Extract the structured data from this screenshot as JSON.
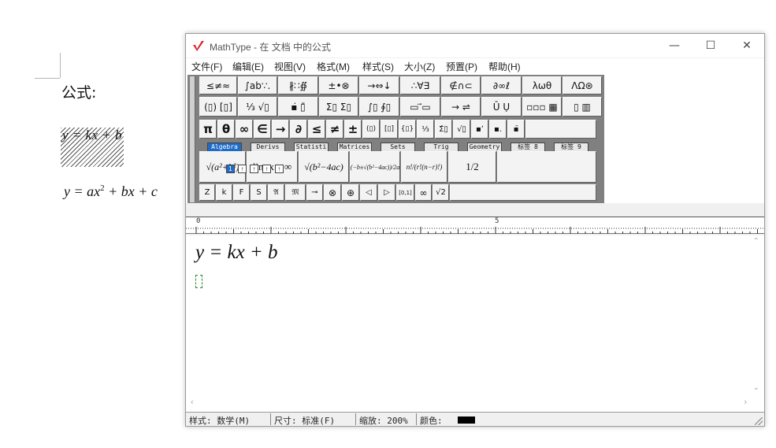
{
  "document": {
    "label": "公式:",
    "eq_selected": "y = kx + b",
    "eq2_part1": "y = ax",
    "eq2_sup": "2",
    "eq2_part2": " + bx + c"
  },
  "window": {
    "title": "MathType - 在 文档 中的公式",
    "minimize": "—",
    "maximize": "☐",
    "close": "✕"
  },
  "menu": [
    "文件(F)",
    "编辑(E)",
    "视图(V)",
    "格式(M)",
    "样式(S)",
    "大小(Z)",
    "预置(P)",
    "帮助(H)"
  ],
  "symbol_row1": [
    "≤≠≈",
    "∫ab∵.",
    "∦∷∯",
    "±•⊗",
    "→⇔↓",
    "∴∀∃",
    "∉∩⊂",
    "∂∞ℓ",
    "λωθ",
    "ΛΩ⊛"
  ],
  "symbol_row2": [
    "(▯) [▯]",
    "⅓ √▯",
    "▪̇ ▯̄",
    "Σ▯ Σ▯",
    "∫▯ ∮▯",
    "▭ ⃗▭",
    "→ ⇌",
    "Ū Ụ",
    "▫▫▫ ▦",
    "▯ ▥"
  ],
  "symbol_row3": [
    "π",
    "θ",
    "∞",
    "∈",
    "→",
    "∂",
    "≤",
    "≠",
    "±",
    "(▯)",
    "[▯]",
    "{▯}",
    "⅓",
    "Σ̂▯",
    "√▯",
    "▪ʼ",
    "▪.",
    "▪̄"
  ],
  "tabs": [
    "Algebra",
    "Derivs",
    "Statisti",
    "Matrices",
    "Sets",
    "Trig",
    "Geometry",
    "标签 8",
    "标签 9"
  ],
  "templates": [
    "√(a²+b²)",
    "lim x→∞",
    "√(b²−4ac)",
    "(−b±√(b²−4ac))/2a",
    "n!/(r!(n−r)!)",
    "1/2"
  ],
  "small_row": [
    "Z",
    "k",
    "F",
    "S",
    "𝔄",
    "𝔐",
    "⊸",
    "⊗",
    "⊕",
    "◁",
    "▷",
    "[0,1]",
    "∞",
    "√2"
  ],
  "size_buttons": [
    "1",
    "↑",
    "↑",
    "↑",
    "↑"
  ],
  "ruler": {
    "start": "0",
    "mid": "5"
  },
  "editor": {
    "equation": "y = kx + b"
  },
  "status": {
    "style": "样式: 数学(M)",
    "size": "尺寸: 标准(F)",
    "zoom": "缩放: 200%",
    "color": "颜色:"
  },
  "colors": {
    "accent": "#1f6cc7",
    "logo": "#d9262b"
  }
}
